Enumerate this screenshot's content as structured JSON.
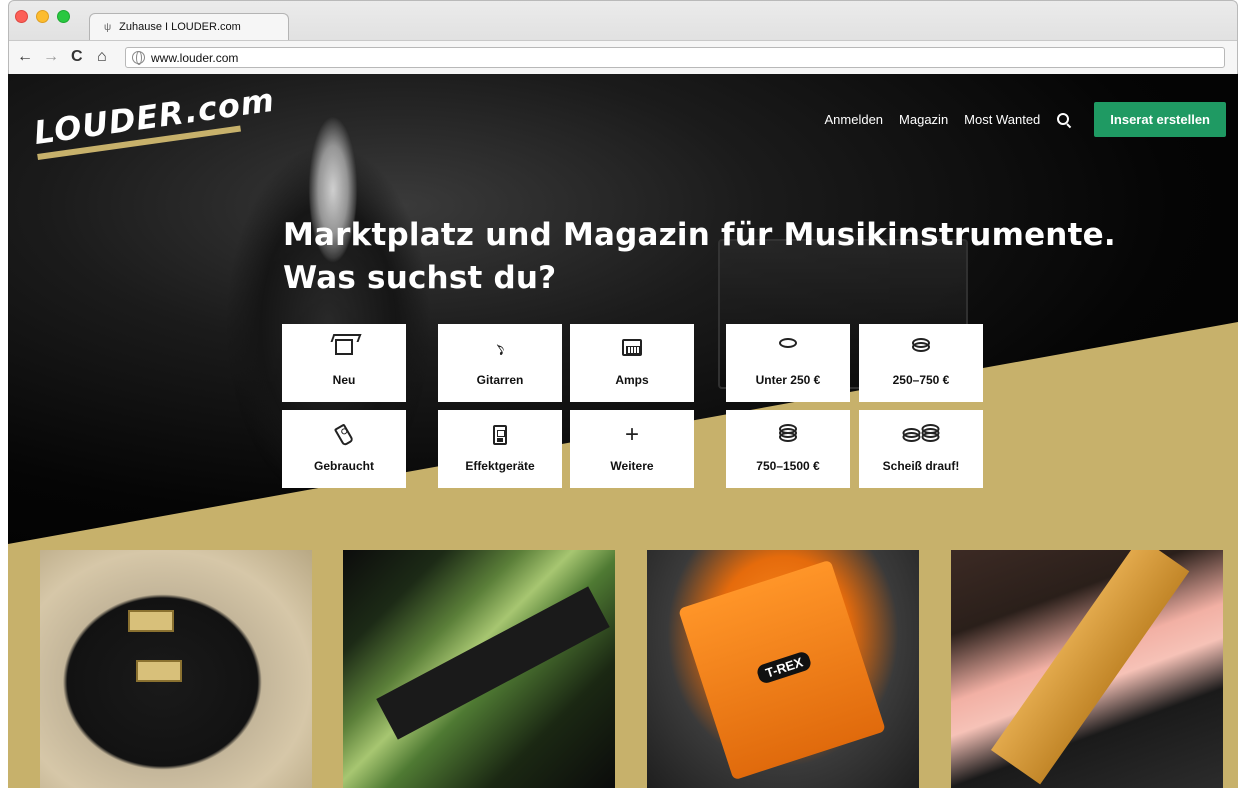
{
  "browser": {
    "tab_title": "Zuhause I LOUDER.com",
    "tab_icon": "ψ",
    "url": "www.louder.com",
    "nav_back": "←",
    "nav_forward": "→",
    "nav_reload": "C",
    "nav_home": "⌂"
  },
  "brand": {
    "logo": "LOUDER.com",
    "accent_color": "#c7b16b",
    "cta_color": "#1f9a63"
  },
  "header": {
    "nav_items": [
      "Anmelden",
      "Magazin",
      "Most Wanted"
    ],
    "search_icon": "search-icon",
    "cta_label": "Inserat erstellen"
  },
  "hero": {
    "headline_line1": "Marktplatz und Magazin für Musikinstrumente.",
    "headline_line2": "Was suchst du?"
  },
  "categories": [
    {
      "label": "Neu",
      "icon": "box-icon"
    },
    {
      "label": "Gitarren",
      "icon": "guitar-icon"
    },
    {
      "label": "Amps",
      "icon": "amp-icon"
    },
    {
      "label": "Gebraucht",
      "icon": "tag-icon"
    },
    {
      "label": "Effektgeräte",
      "icon": "pedal-icon"
    },
    {
      "label": "Weitere",
      "icon": "plus-icon"
    }
  ],
  "price_ranges": [
    {
      "label": "Unter 250 €",
      "icon": "coin-icon"
    },
    {
      "label": "250–750 €",
      "icon": "coin-stack-icon"
    },
    {
      "label": "750–1500 €",
      "icon": "coin-stack-tall-icon"
    },
    {
      "label": "Scheiß drauf!",
      "icon": "coin-stacks-icon"
    }
  ],
  "featured": {
    "card_1_pedal_text": "T-REX"
  }
}
